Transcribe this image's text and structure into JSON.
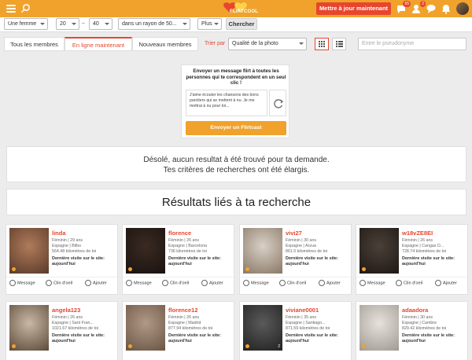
{
  "topbar": {
    "logo_text": "FLIRTCOOL",
    "update_button": "Mettre à jour maintenant",
    "badges": {
      "messages": "65",
      "visits": "2"
    },
    "colors": {
      "bar": "#f0a22c",
      "accent": "#e8452e"
    }
  },
  "filters": {
    "gender": "Une femme",
    "age_min": "20",
    "age_max": "40",
    "radius": "dans un rayon de 50...",
    "more": "Plus",
    "search_button": "Chercher"
  },
  "tabs": {
    "all": "Tous les membres",
    "online": "En ligne maintenant",
    "new": "Nouveaux membres",
    "sort_label": "Trier par",
    "sort_value": "Qualité de la photo",
    "pseudo_placeholder": "Entre le pseudonyme"
  },
  "flirtcast": {
    "title": "Envoyer un message flirt à toutes les personnes qui te correspondent en un seul clic !",
    "message": "J'aime écouter les chansons des bons paroliers qui se mettent à nu. Je me mettrai à nu pour toi...",
    "send_button": "Envoyer un Flirtcast"
  },
  "noresult": {
    "line1": "Désolé, aucun resultat à été trouvé pour ta demande.",
    "line2": "Tes critères de recherches ont été élargis."
  },
  "results_title": "Résultats liés à ta recherche",
  "card_labels": {
    "last_visit": "Dernière visite sur le site: aujourd'hui",
    "message": "Message",
    "wink": "Clin d'oeil",
    "add": "Ajouter"
  },
  "members": [
    {
      "name": "linda",
      "line1": "Féminin | 29 ans",
      "line2": "Espagne | Bilbo",
      "line3": "564.48 kilomètres de toi"
    },
    {
      "name": "florence",
      "line1": "Féminin | 26 ans",
      "line2": "Espagne | Barcelona",
      "line3": "736 kilomètres de toi"
    },
    {
      "name": "vivi27",
      "line1": "Féminin | 30 ans",
      "line2": "Espagne | Arzua",
      "line3": "861.5 kilomètres de toi"
    },
    {
      "name": "w18vZE8EI",
      "line1": "Féminin | 26 ans",
      "line2": "Espagne | Cangas D...",
      "line3": "728.74 kilomètres de toi"
    },
    {
      "name": "angela123",
      "line1": "Féminin | 26 ans",
      "line2": "Espagne | Sant Fran...",
      "line3": "1021.67 kilomètres de toi"
    },
    {
      "name": "florence12",
      "line1": "Féminin | 26 ans",
      "line2": "Espagne | Madrid",
      "line3": "877.94 kilomètres de toi"
    },
    {
      "name": "viviane0001",
      "line1": "Féminin | 35 ans",
      "line2": "Espagne | Santiago...",
      "line3": "871.59 kilomètres de toi",
      "photo_count": "2"
    },
    {
      "name": "adaadora",
      "line1": "Féminin | 30 ans",
      "line2": "Espagne | Cambre",
      "line3": "829.42 kilomètres de toi"
    }
  ]
}
